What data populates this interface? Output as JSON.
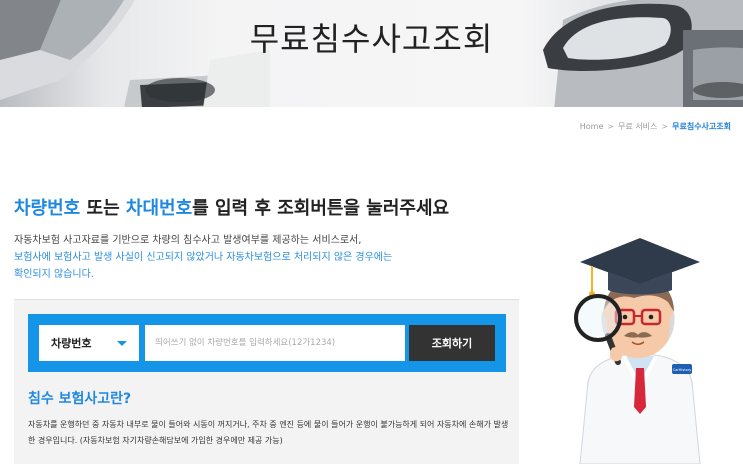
{
  "banner": {
    "title": "무료침수사고조회"
  },
  "breadcrumb": {
    "home": "Home",
    "sep1": ">",
    "level1": "무료 서비스",
    "sep2": ">",
    "current": "무료침수사고조회"
  },
  "heading": {
    "part1": "차량번호",
    "part2": " 또는 ",
    "part3": "차대번호",
    "part4": "를 입력 후 조회버튼을 눌러주세요"
  },
  "description": {
    "line1": "자동차보험 사고자료를 기반으로 차량의 침수사고 발생여부를 제공하는 서비스로서,",
    "line2": "보험사에 보험사고 발생 사실이 신고되지 않았거나 자동차보험으로 처리되지 않은 경우에는",
    "line3": "확인되지 않습니다."
  },
  "search": {
    "select_value": "차량번호",
    "input_placeholder": "띄어쓰기 없이 차량번호를 입력하세요(12가1234)",
    "input_value": "",
    "button_label": "조회하기"
  },
  "info": {
    "title": "침수 보험사고란?",
    "text": "자동차를 운행하던 중 자동차 내부로 물이 들어와 시동이 꺼지거나, 주차 중 엔진 등에 물이 들어가 운행이 불가능하게 되어 자동차에 손해가 발생한 경우입니다. (자동차보험 자기차량손해담보에 가입한 경우에만 제공 가능)"
  },
  "illustration": {
    "badge_text": "CarHistory"
  },
  "colors": {
    "accent": "#1595e8",
    "highlight": "#1f88e0",
    "button": "#333333"
  }
}
